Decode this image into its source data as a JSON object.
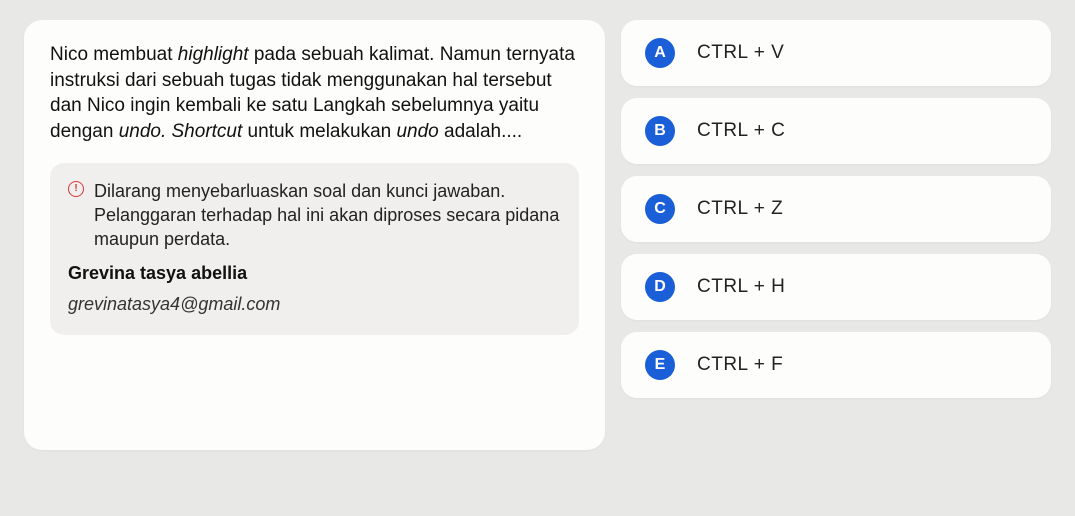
{
  "question": {
    "text_segments": [
      {
        "t": "Nico membuat ",
        "i": false
      },
      {
        "t": "highlight",
        "i": true
      },
      {
        "t": " pada sebuah kalimat. Namun ternyata instruksi dari sebuah tugas tidak menggunakan hal tersebut dan Nico ingin kembali ke satu Langkah sebelumnya yaitu dengan ",
        "i": false
      },
      {
        "t": "undo. Shortcut",
        "i": true
      },
      {
        "t": " untuk melakukan ",
        "i": false
      },
      {
        "t": "undo",
        "i": true
      },
      {
        "t": " adalah....",
        "i": false
      }
    ]
  },
  "notice": {
    "icon_glyph": "①",
    "text": "Dilarang menyebarluaskan soal dan kunci jawaban. Pelanggaran terhadap hal ini akan diproses secara pidana maupun perdata.",
    "author_name": "Grevina tasya abellia",
    "author_email": "grevinatasya4@gmail.com"
  },
  "options": [
    {
      "letter": "A",
      "label": "CTRL + V"
    },
    {
      "letter": "B",
      "label": "CTRL + C"
    },
    {
      "letter": "C",
      "label": "CTRL + Z"
    },
    {
      "letter": "D",
      "label": "CTRL + H"
    },
    {
      "letter": "E",
      "label": "CTRL + F"
    }
  ]
}
